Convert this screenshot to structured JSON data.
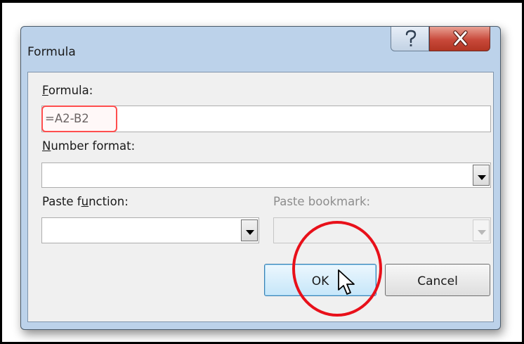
{
  "dialog": {
    "title": "Formula",
    "help_icon": "help-icon",
    "close_icon": "close-icon"
  },
  "formula": {
    "label_accel": "F",
    "label_rest": "ormula:",
    "value": "=A2-B2"
  },
  "number_format": {
    "label_accel": "N",
    "label_rest": "umber format:",
    "value": ""
  },
  "paste_function": {
    "label_before": "Paste f",
    "label_accel": "u",
    "label_after": "nction:",
    "value": ""
  },
  "paste_bookmark": {
    "label": "Paste bookmark:",
    "value": ""
  },
  "buttons": {
    "ok": "OK",
    "cancel": "Cancel"
  },
  "annotations": {
    "highlight_color": "#ff4e4e",
    "circle_color": "#e8101a",
    "cursor_icon": "mouse-pointer-icon"
  }
}
